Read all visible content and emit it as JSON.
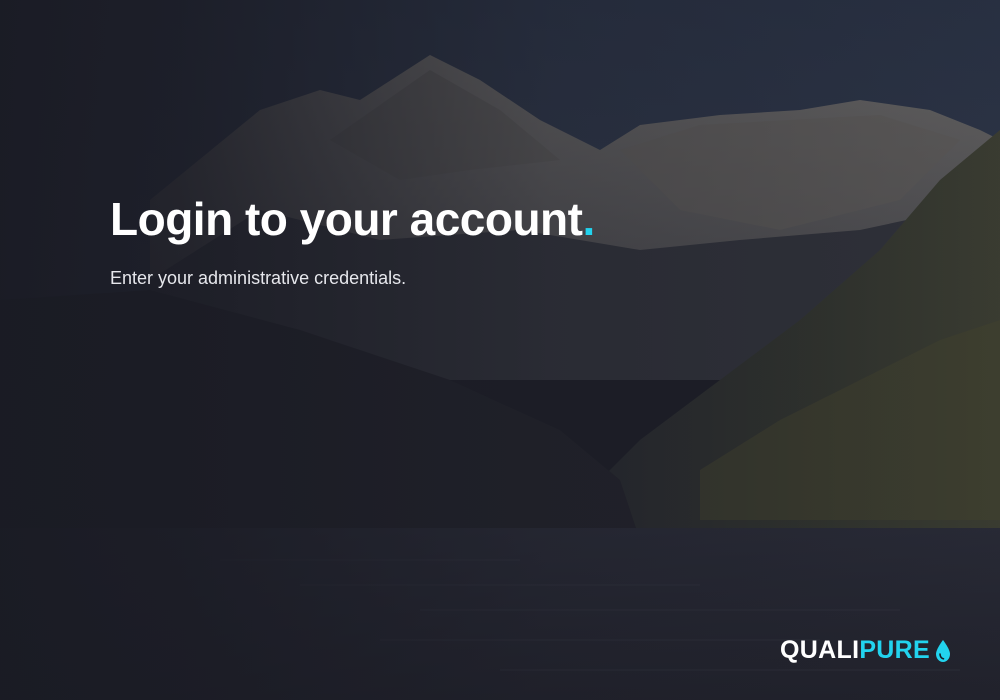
{
  "login": {
    "title": "Login to your account",
    "title_dot": ".",
    "subtitle": "Enter your administrative credentials."
  },
  "brand": {
    "name_part1": "QUALI",
    "name_part2": "PURE",
    "icon": "water-drop-icon"
  },
  "colors": {
    "accent": "#22d3ee",
    "background": "#1a1b24",
    "text_primary": "#ffffff"
  }
}
